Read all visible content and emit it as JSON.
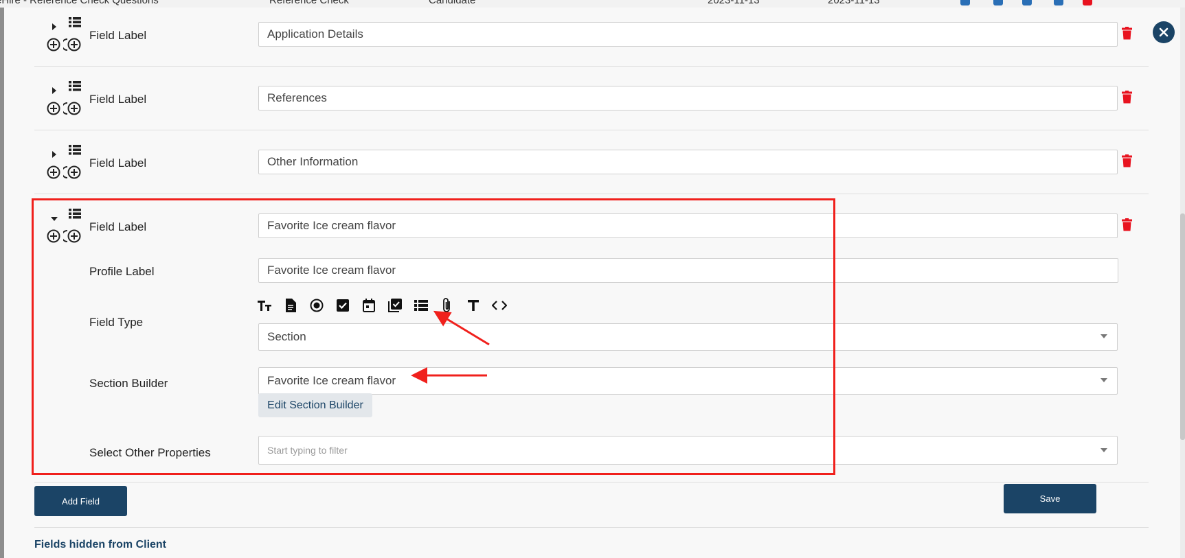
{
  "background": {
    "title": "eHire - Reference Check Questions",
    "type": "Reference Check",
    "audience": "Candidate",
    "date_created": "2023-11-13",
    "date_modified": "2023-11-13"
  },
  "rows": [
    {
      "label": "Field Label",
      "value": "Application Details"
    },
    {
      "label": "Field Label",
      "value": "References"
    },
    {
      "label": "Field Label",
      "value": "Other Information"
    }
  ],
  "expanded": {
    "field_label": "Field Label",
    "field_value": "Favorite Ice cream flavor",
    "profile_label": "Profile Label",
    "profile_value": "Favorite Ice cream flavor",
    "field_type_label": "Field Type",
    "field_type_value": "Section",
    "section_builder_label": "Section Builder",
    "section_builder_value": "Favorite Ice cream flavor",
    "edit_button": "Edit Section Builder",
    "other_props_label": "Select Other Properties",
    "other_props_placeholder": "Start typing to filter"
  },
  "field_type_icons": [
    "text-size-icon",
    "document-icon",
    "radio-icon",
    "checkbox-icon",
    "calendar-icon",
    "checklist-icon",
    "list-icon",
    "attachment-icon",
    "text-icon",
    "code-icon"
  ],
  "buttons": {
    "add_field": "Add Field",
    "save": "Save"
  },
  "hidden_section_title": "Fields hidden from Client",
  "colors": {
    "primary": "#1b4466",
    "danger": "#e8131f",
    "highlight": "#f0201c"
  }
}
